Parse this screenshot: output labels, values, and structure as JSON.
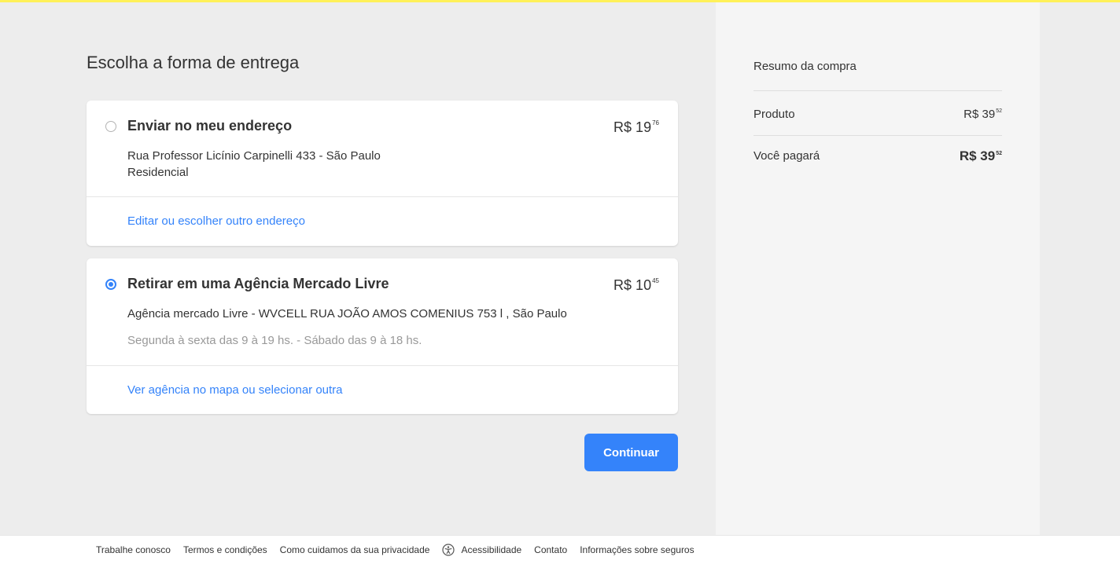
{
  "main": {
    "title": "Escolha a forma de entrega",
    "options": [
      {
        "title": "Enviar no meu endereço",
        "price_main": "R$ 19",
        "price_cents": "76",
        "selected": false,
        "line1": "Rua Professor Licínio Carpinelli 433 - São Paulo",
        "line2": "Residencial",
        "link": "Editar ou escolher outro endereço"
      },
      {
        "title": "Retirar em uma Agência Mercado Livre",
        "price_main": "R$ 10",
        "price_cents": "45",
        "selected": true,
        "line1": "Agência mercado Livre - WVCELL RUA JOÃO AMOS COMENIUS 753 l , São Paulo",
        "line2": "Segunda à sexta das 9 à 19 hs. - Sábado das 9 à 18 hs.",
        "link": "Ver agência no mapa ou selecionar outra"
      }
    ],
    "continue_label": "Continuar"
  },
  "summary": {
    "title": "Resumo da compra",
    "product_label": "Produto",
    "product_price_main": "R$ 39",
    "product_price_cents": "52",
    "total_label": "Você pagará",
    "total_price_main": "R$ 39",
    "total_price_cents": "52"
  },
  "footer": {
    "links": [
      "Trabalhe conosco",
      "Termos e condições",
      "Como cuidamos da sua privacidade",
      "Acessibilidade",
      "Contato",
      "Informações sobre seguros"
    ],
    "accessibility_icon": "accessibility-icon"
  },
  "colors": {
    "accent": "#3483fa",
    "top_bar": "#fff159",
    "background": "#ededed",
    "summary_background": "#f5f5f5"
  }
}
